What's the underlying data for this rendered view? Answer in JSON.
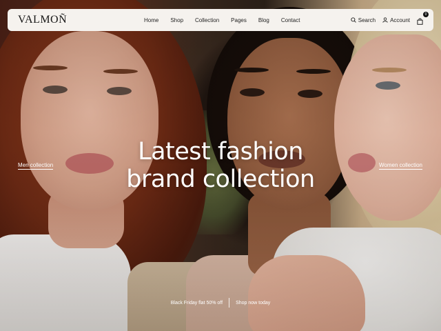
{
  "brand": {
    "logo": "VALMOÑ"
  },
  "nav": {
    "items": [
      {
        "id": "home",
        "label": "Home"
      },
      {
        "id": "shop",
        "label": "Shop"
      },
      {
        "id": "collection",
        "label": "Collection"
      },
      {
        "id": "pages",
        "label": "Pages"
      },
      {
        "id": "blog",
        "label": "Blog"
      },
      {
        "id": "contact",
        "label": "Contact"
      }
    ]
  },
  "header_actions": {
    "search_label": "Search",
    "search_icon": "search-icon",
    "account_label": "Account",
    "account_icon": "user-icon",
    "cart_icon": "shopping-bag-icon",
    "cart_count": "0"
  },
  "hero": {
    "headline_line1": "Latest fashion",
    "headline_line2": "brand collection",
    "left_link": "Men collection",
    "right_link": "Women collection"
  },
  "promo": {
    "offer_text": "Black Friday flat 50% off",
    "cta_text": "Shop now today"
  },
  "colors": {
    "header_bg": "#f5f2ee",
    "text_dark": "#151515",
    "hero_text": "#ffffff"
  }
}
